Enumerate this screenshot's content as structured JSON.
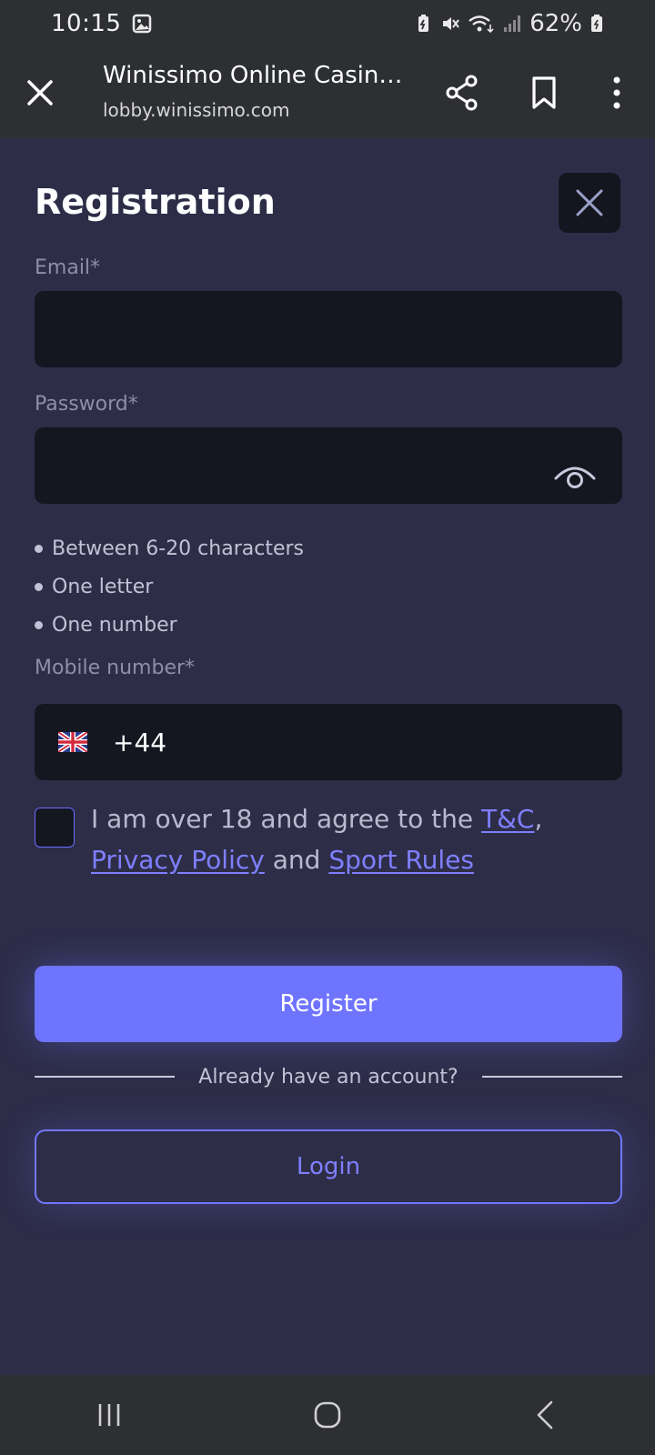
{
  "status_bar": {
    "time": "10:15",
    "battery": "62%",
    "icons": [
      "image-icon",
      "battery-saver-icon",
      "mute-icon",
      "wifi-icon",
      "signal-icon",
      "battery-icon"
    ]
  },
  "browser": {
    "title": "Winissimo Online Casino ...",
    "url": "lobby.winissimo.com",
    "icons": [
      "close-icon",
      "share-icon",
      "bookmark-icon",
      "more-icon"
    ]
  },
  "form": {
    "title": "Registration",
    "email_label": "Email*",
    "email_value": "",
    "password_label": "Password*",
    "password_value": "",
    "password_rules": [
      "Between 6-20 characters",
      "One letter",
      "One number"
    ],
    "mobile_label": "Mobile number*",
    "country_code": "+44",
    "agree_prefix": "I am over 18 and agree to the ",
    "agree_tc": "T&C",
    "agree_comma": ",",
    "agree_privacy": "Privacy Policy",
    "agree_and": " and ",
    "agree_sport": "Sport Rules",
    "register_label": "Register",
    "account_prompt": "Already have an account?",
    "login_label": "Login"
  },
  "colors": {
    "background": "#2d2d48",
    "input_bg": "#141620",
    "accent": "#6f74ff",
    "link": "#7f7fff",
    "label": "#8e8ea8"
  }
}
